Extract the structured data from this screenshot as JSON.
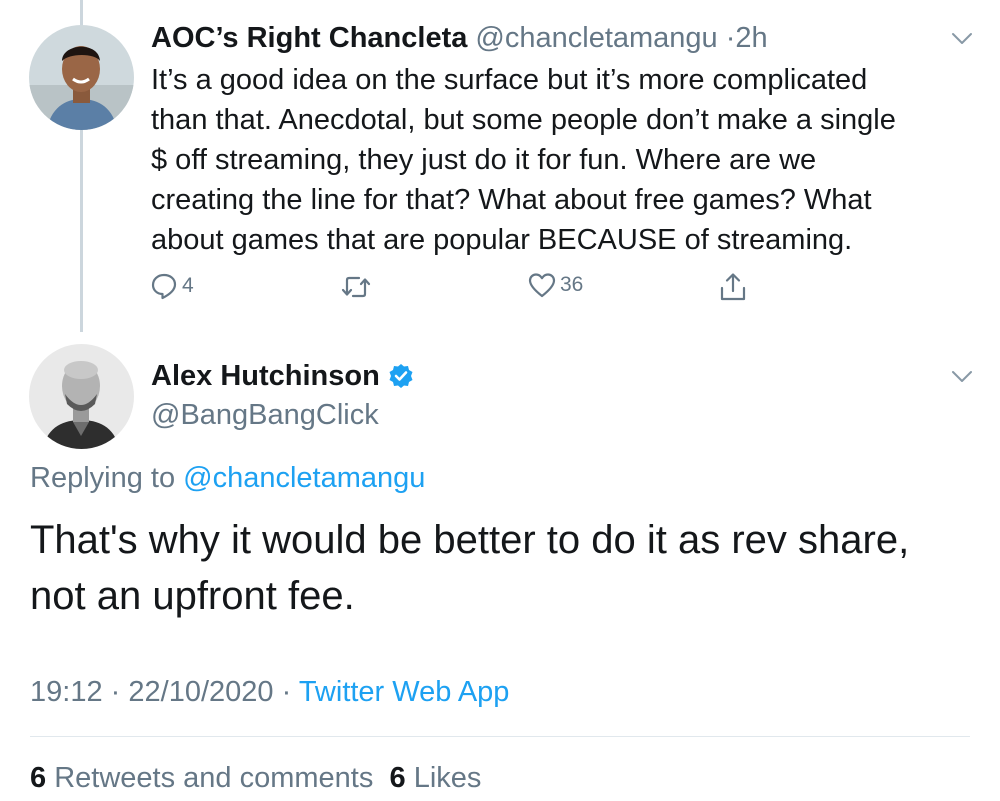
{
  "parent_tweet": {
    "display_name": "AOC’s Right Chancleta",
    "handle": "@chancletamangu",
    "time_ago": "2h",
    "separator": "·",
    "body_lines": [
      "It’s a good idea on the surface but it’s more complicated",
      "than that. Anecdotal, but some people don’t make a single",
      "$ off streaming, they just do it for fun. Where are we",
      "creating the line for that? What about free games? What",
      "about games that are popular BECAUSE of streaming."
    ],
    "reply_count": "4",
    "like_count": "36",
    "icons": [
      "chevron-down-icon",
      "reply-icon",
      "retweet-icon",
      "like-icon",
      "share-icon"
    ]
  },
  "main_tweet": {
    "display_name": "Alex Hutchinson",
    "verified": true,
    "handle": "@BangBangClick",
    "replying_prefix": "Replying to",
    "replying_to": "@chancletamangu",
    "body_lines": [
      "That's why it would be better to do it as rev share,",
      "not an upfront fee."
    ],
    "time": "19:12",
    "date": "22/10/2020",
    "separator": "·",
    "source": "Twitter Web App",
    "retweets_count": "6",
    "retweets_label": "Retweets and comments",
    "likes_count": "6",
    "likes_label": "Likes"
  },
  "colors": {
    "text": "#14171a",
    "secondary": "#657786",
    "link": "#1da1f2",
    "verified": "#1da1f2",
    "thread_line": "#ccd6dd",
    "divider": "#e1e8ed"
  }
}
